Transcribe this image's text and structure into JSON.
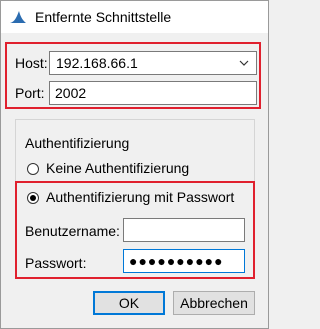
{
  "window": {
    "title": "Entfernte Schnittstelle",
    "icon": "shark-fin-icon"
  },
  "connection": {
    "host_label": "Host:",
    "host_value": "192.168.66.1",
    "port_label": "Port:",
    "port_value": "2002"
  },
  "auth": {
    "group_label": "Authentifizierung",
    "option_none": "Keine Authentifizierung",
    "option_password": "Authentifizierung mit Passwort",
    "selected": "password",
    "username_label": "Benutzername:",
    "username_value": "",
    "password_label": "Passwort:",
    "password_value": "●●●●●●●●●●"
  },
  "buttons": {
    "ok": "OK",
    "cancel": "Abbrechen"
  },
  "colors": {
    "highlight": "#e0202e",
    "accent": "#0078d7",
    "icon_blue": "#2b6cb0"
  }
}
